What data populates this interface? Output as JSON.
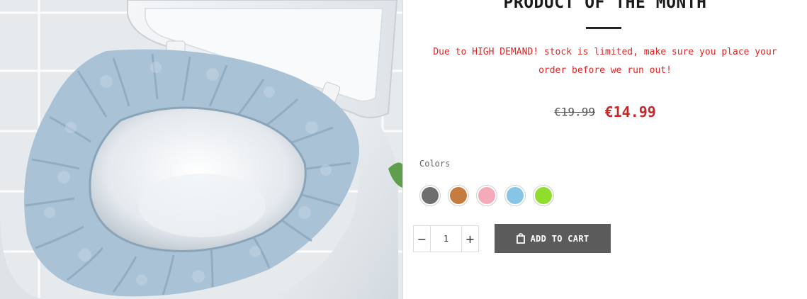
{
  "product": {
    "image_alt": "Light blue knitted toilet seat cover on a white toilet",
    "heading": "PRODUCT OF THE MONTH",
    "notice": "Due to HIGH DEMAND! stock is limited, make sure you place your order before we run out!",
    "price_old": "€19.99",
    "price_new": "€14.99"
  },
  "options": {
    "colors_label": "Colors",
    "swatches": [
      {
        "name": "gray",
        "color": "#6e6e6e"
      },
      {
        "name": "brown",
        "color": "#c47d3e"
      },
      {
        "name": "pink",
        "color": "#f4aab9"
      },
      {
        "name": "light-blue",
        "color": "#86c5e6"
      },
      {
        "name": "lime-green",
        "color": "#8fde2e"
      }
    ]
  },
  "cart": {
    "quantity": "1",
    "minus_label": "−",
    "plus_label": "+",
    "button_icon": "shopping-bag-icon",
    "button_label": "ADD TO CART"
  },
  "colors": {
    "notice_red": "#e02424",
    "price_red": "#c62828",
    "button_gray": "#5b5b5b"
  }
}
